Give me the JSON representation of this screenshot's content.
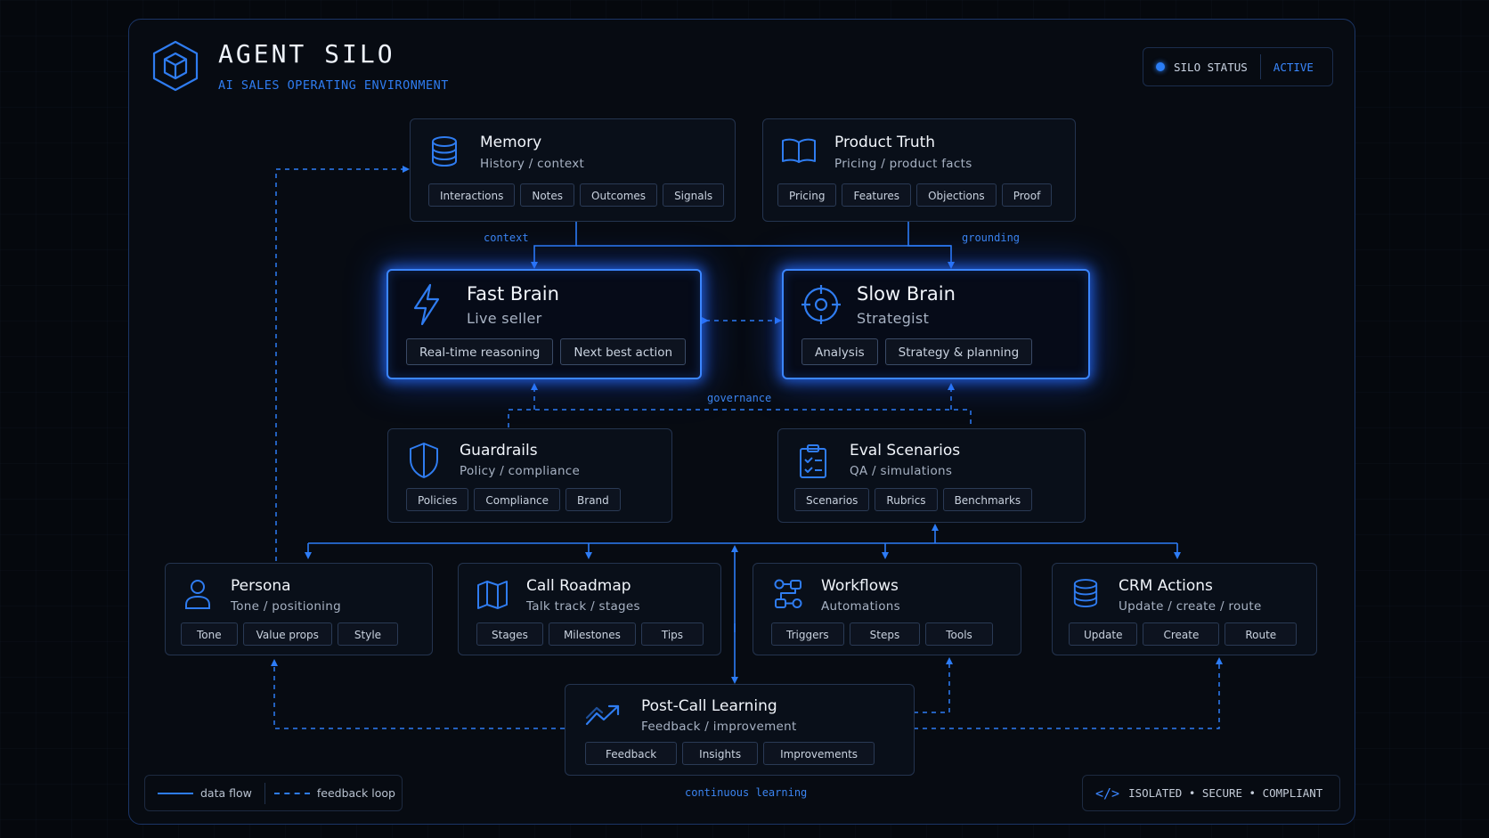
{
  "header": {
    "title": "AGENT SILO",
    "subtitle": "AI SALES OPERATING ENVIRONMENT",
    "status_label": "SILO STATUS",
    "status_value": "ACTIVE"
  },
  "colors": {
    "accent": "#2f7cf0",
    "background": "#05080d",
    "card_border": "#24344f"
  },
  "nodes": {
    "memory": {
      "icon": "database-icon",
      "title": "Memory",
      "subtitle": "History / context",
      "tags": [
        "Interactions",
        "Notes",
        "Outcomes",
        "Signals"
      ]
    },
    "product_truth": {
      "icon": "book-icon",
      "title": "Product Truth",
      "subtitle": "Pricing / product facts",
      "tags": [
        "Pricing",
        "Features",
        "Objections",
        "Proof"
      ]
    },
    "fast_brain": {
      "icon": "lightning-icon",
      "title": "Fast Brain",
      "subtitle": "Live seller",
      "tags": [
        "Real-time reasoning",
        "Next best action"
      ]
    },
    "slow_brain": {
      "icon": "target-icon",
      "title": "Slow Brain",
      "subtitle": "Strategist",
      "tags": [
        "Analysis",
        "Strategy & planning"
      ]
    },
    "guardrails": {
      "icon": "shield-icon",
      "title": "Guardrails",
      "subtitle": "Policy / compliance",
      "tags": [
        "Policies",
        "Compliance",
        "Brand"
      ]
    },
    "eval_scenarios": {
      "icon": "clipboard-icon",
      "title": "Eval Scenarios",
      "subtitle": "QA / simulations",
      "tags": [
        "Scenarios",
        "Rubrics",
        "Benchmarks"
      ]
    },
    "persona": {
      "icon": "user-icon",
      "title": "Persona",
      "subtitle": "Tone / positioning",
      "tags": [
        "Tone",
        "Value props",
        "Style"
      ]
    },
    "call_roadmap": {
      "icon": "map-icon",
      "title": "Call Roadmap",
      "subtitle": "Talk track / stages",
      "tags": [
        "Stages",
        "Milestones",
        "Tips"
      ]
    },
    "workflows": {
      "icon": "workflow-icon",
      "title": "Workflows",
      "subtitle": "Automations",
      "tags": [
        "Triggers",
        "Steps",
        "Tools"
      ]
    },
    "crm_actions": {
      "icon": "database-icon",
      "title": "CRM Actions",
      "subtitle": "Update / create / route",
      "tags": [
        "Update",
        "Create",
        "Route"
      ]
    },
    "post_call": {
      "icon": "trend-up-icon",
      "title": "Post-Call Learning",
      "subtitle": "Feedback / improvement",
      "tags": [
        "Feedback",
        "Insights",
        "Improvements"
      ]
    }
  },
  "edge_labels": {
    "context": "context",
    "grounding": "grounding",
    "governance": "governance",
    "continuous_learning": "continuous learning"
  },
  "legend": {
    "solid": "data flow",
    "dashed": "feedback loop"
  },
  "footer": {
    "icon": "code-icon",
    "text": "ISOLATED • SECURE • COMPLIANT"
  }
}
